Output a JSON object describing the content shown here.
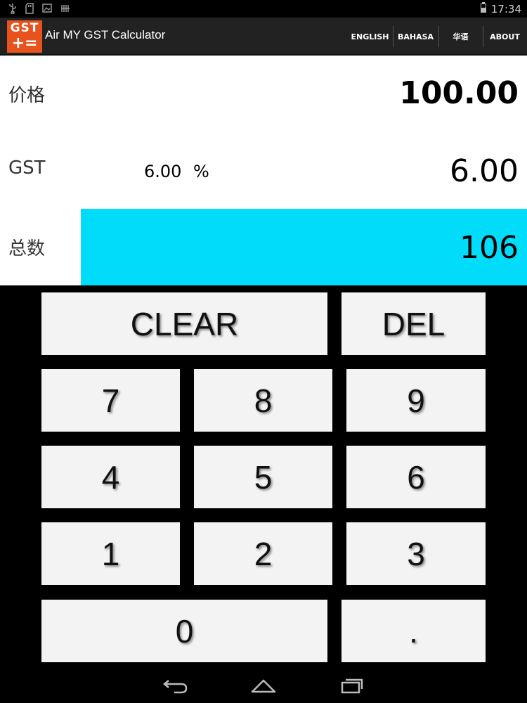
{
  "status_bar": {
    "time": "17:34"
  },
  "app": {
    "logo_top": "GST",
    "logo_bottom": "+=",
    "title": "Air MY GST Calculator",
    "brand_color": "#e8531d"
  },
  "menu": {
    "english": "ENGLISH",
    "bahasa": "BAHASA",
    "chinese": "华语",
    "about": "ABOUT"
  },
  "display": {
    "price_label": "价格",
    "price_value": "100.00",
    "gst_label": "GST",
    "gst_rate": "6.00",
    "gst_percent": "%",
    "gst_value": "6.00",
    "total_label": "总数",
    "total_value": "106",
    "total_highlight_color": "#00dcfa"
  },
  "keypad": {
    "clear": "CLEAR",
    "del": "DEL",
    "k7": "7",
    "k8": "8",
    "k9": "9",
    "k4": "4",
    "k5": "5",
    "k6": "6",
    "k1": "1",
    "k2": "2",
    "k3": "3",
    "k0": "0",
    "dot": "."
  },
  "nav_bar": {
    "icons": [
      "back-icon",
      "home-icon",
      "recent-apps-icon"
    ]
  }
}
